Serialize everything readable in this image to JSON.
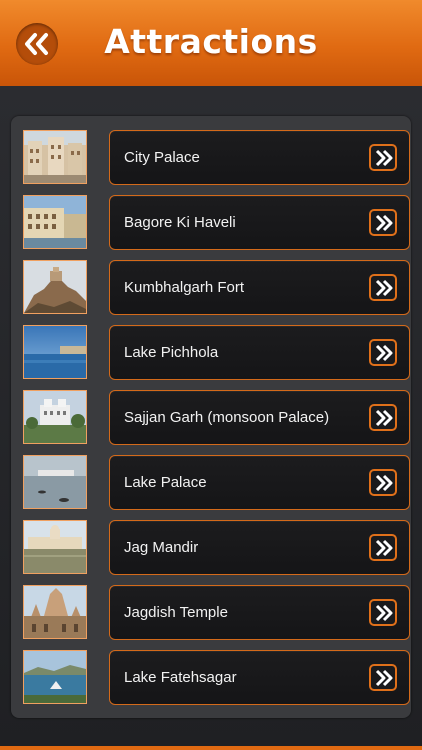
{
  "header": {
    "title": "Attractions",
    "back_icon": "double-chevron-left-icon",
    "accent_color": "#e36c14"
  },
  "list": {
    "items": [
      {
        "label": "City Palace"
      },
      {
        "label": "Bagore Ki Haveli"
      },
      {
        "label": "Kumbhalgarh Fort"
      },
      {
        "label": "Lake Pichhola"
      },
      {
        "label": "Sajjan Garh (monsoon Palace)"
      },
      {
        "label": "Lake Palace"
      },
      {
        "label": "Jag Mandir"
      },
      {
        "label": "Jagdish Temple"
      },
      {
        "label": "Lake Fatehsagar"
      }
    ],
    "row_icon": "double-chevron-right-icon"
  }
}
